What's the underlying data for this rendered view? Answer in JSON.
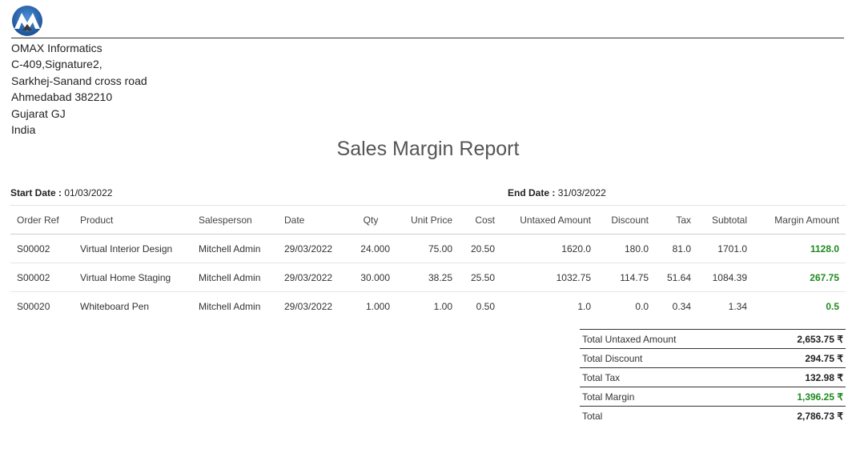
{
  "company": {
    "address_lines": [
      "OMAX Informatics",
      "C-409,Signature2,",
      "Sarkhej-Sanand cross road",
      "Ahmedabad 382210",
      "Gujarat GJ",
      "India"
    ]
  },
  "report": {
    "title": "Sales Margin Report",
    "start_label": "Start Date :",
    "start_value": "01/03/2022",
    "end_label": "End Date :",
    "end_value": "31/03/2022"
  },
  "table": {
    "headers": [
      "Order Ref",
      "Product",
      "Salesperson",
      "Date",
      "Qty",
      "Unit Price",
      "Cost",
      "Untaxed Amount",
      "Discount",
      "Tax",
      "Subtotal",
      "Margin Amount"
    ],
    "rows": [
      [
        "S00002",
        "Virtual Interior Design",
        "Mitchell Admin",
        "29/03/2022",
        "24.000",
        "75.00",
        "20.50",
        "1620.0",
        "180.0",
        "81.0",
        "1701.0",
        "1128.0"
      ],
      [
        "S00002",
        "Virtual Home Staging",
        "Mitchell Admin",
        "29/03/2022",
        "30.000",
        "38.25",
        "25.50",
        "1032.75",
        "114.75",
        "51.64",
        "1084.39",
        "267.75"
      ],
      [
        "S00020",
        "Whiteboard Pen",
        "Mitchell Admin",
        "29/03/2022",
        "1.000",
        "1.00",
        "0.50",
        "1.0",
        "0.0",
        "0.34",
        "1.34",
        "0.5"
      ]
    ]
  },
  "totals": [
    {
      "label": "Total Untaxed Amount",
      "value": "2,653.75 ₹"
    },
    {
      "label": "Total Discount",
      "value": "294.75 ₹"
    },
    {
      "label": "Total Tax",
      "value": "132.98 ₹"
    },
    {
      "label": "Total Margin",
      "value": "1,396.25 ₹"
    },
    {
      "label": "Total",
      "value": "2,786.73 ₹"
    }
  ],
  "colors": {
    "margin_green": "#1f8a1f",
    "logo_blue": "#2a6db5"
  },
  "icons": {
    "logo": "company-logo"
  }
}
